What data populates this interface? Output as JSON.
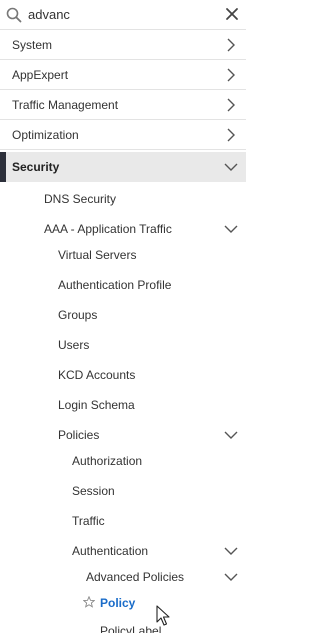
{
  "search": {
    "value": "advanc"
  },
  "nav": {
    "system": "System",
    "appexpert": "AppExpert",
    "traffic_management": "Traffic Management",
    "optimization": "Optimization",
    "security": "Security",
    "dns_security": "DNS Security",
    "aaa_application_traffic": "AAA - Application Traffic",
    "virtual_servers": "Virtual Servers",
    "authentication_profile": "Authentication Profile",
    "groups": "Groups",
    "users": "Users",
    "kcd_accounts": "KCD Accounts",
    "login_schema": "Login Schema",
    "policies": "Policies",
    "authorization": "Authorization",
    "session": "Session",
    "traffic": "Traffic",
    "authentication": "Authentication",
    "advanced_policies": "Advanced Policies",
    "policy": "Policy",
    "policy_label": "PolicyLabel"
  },
  "colors": {
    "active_bar": "#2c2f3a",
    "active_bg": "#e9e9e9",
    "selected_link": "#1a6cc9"
  },
  "icons": {
    "search": "search-icon",
    "clear": "close-icon",
    "expand": "chevron-right-icon",
    "collapse": "chevron-down-icon",
    "favorite": "star-outline-icon",
    "pointer": "mouse-cursor-icon"
  }
}
